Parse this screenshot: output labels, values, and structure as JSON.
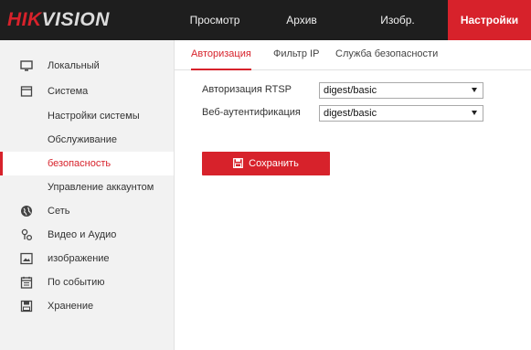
{
  "brand": {
    "logo_left": "HIK",
    "logo_right": "VISION"
  },
  "top_nav": [
    {
      "label": "Просмотр",
      "active": false
    },
    {
      "label": "Архив",
      "active": false
    },
    {
      "label": "Изобр.",
      "active": false
    },
    {
      "label": "Настройки",
      "active": true
    }
  ],
  "sidebar": {
    "items": [
      {
        "label": "Локальный",
        "icon": "monitor-icon"
      },
      {
        "label": "Система",
        "icon": "system-icon"
      },
      {
        "label": "Настройки системы",
        "sub": true
      },
      {
        "label": "Обслуживание",
        "sub": true
      },
      {
        "label": "безопасность",
        "sub": true,
        "active": true
      },
      {
        "label": "Управление аккаунтом",
        "sub": true
      },
      {
        "label": "Сеть",
        "icon": "globe-icon"
      },
      {
        "label": "Видео и Аудио",
        "icon": "video-audio-icon"
      },
      {
        "label": "изображение",
        "icon": "image-icon"
      },
      {
        "label": "По событию",
        "icon": "calendar-icon"
      },
      {
        "label": "Хранение",
        "icon": "storage-icon"
      }
    ]
  },
  "tabs": [
    {
      "label": "Авторизация",
      "active": true
    },
    {
      "label": "Фильтр IP",
      "active": false
    },
    {
      "label": "Служба безопасности",
      "active": false
    }
  ],
  "form": {
    "rtsp_label": "Авторизация RTSP",
    "rtsp_value": "digest/basic",
    "web_label": "Веб-аутентификация",
    "web_value": "digest/basic"
  },
  "save_button": {
    "label": "Сохранить"
  },
  "colors": {
    "accent": "#d7222b",
    "topbar": "#1e1e1e",
    "sidebar": "#f2f2f2"
  }
}
